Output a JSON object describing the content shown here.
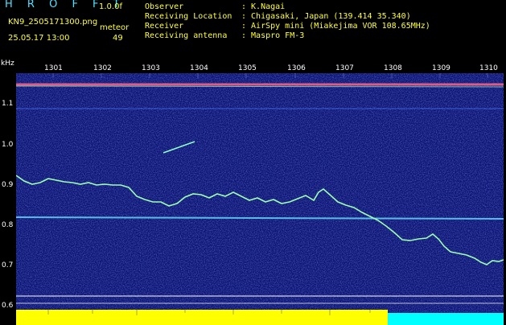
{
  "header": {
    "title": "H R O F F T",
    "version": "1.0.0f",
    "filename": "KN9_2505171300.png",
    "datetime": "25.05.17 13:00",
    "meteor_label": "meteor",
    "meteor_count": "49",
    "info": [
      {
        "key": "Observer",
        "value": ": K.Nagai"
      },
      {
        "key": "Receiving Location",
        "value": ": Chigasaki, Japan (139.414 35.340)"
      },
      {
        "key": "Receiver",
        "value": ": AirSpy mini (Miakejima VOR 108.65MHz)"
      },
      {
        "key": "Receiving antenna",
        "value": ": Maspro FM-3"
      }
    ]
  },
  "spectrogram": {
    "freq_unit": "kHz",
    "x_ticks": [
      "1301",
      "1302",
      "1303",
      "1304",
      "1305",
      "1306",
      "1307",
      "1308",
      "1309",
      "1310"
    ],
    "y_ticks": [
      "1.1",
      "1.0",
      "0.9",
      "0.8",
      "0.7",
      "0.6"
    ],
    "colors": {
      "background": "#0a1170",
      "signal": "#9dffb0",
      "carrier": "#ff6688",
      "level_bar": "#ffff00",
      "level_bar_low": "#00ffff"
    }
  }
}
